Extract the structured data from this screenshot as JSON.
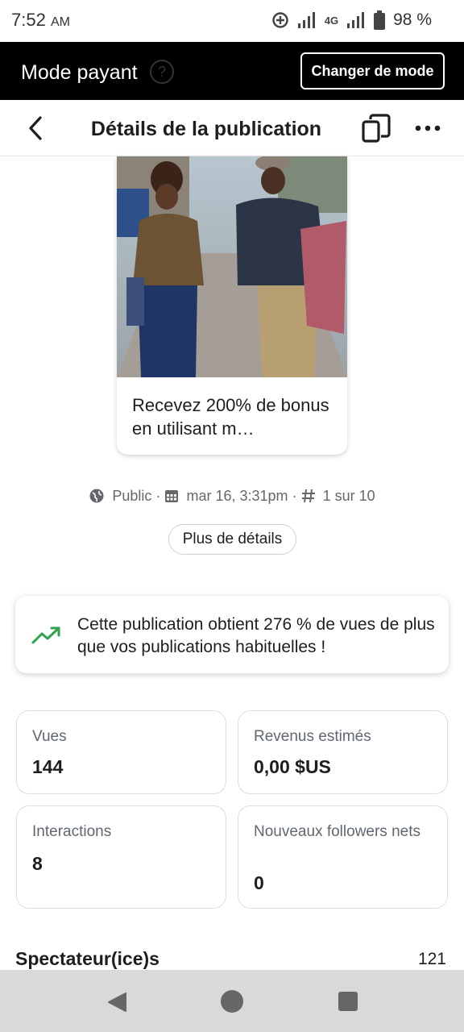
{
  "status_bar": {
    "time": "7:52",
    "ampm": "AM",
    "network": "4G",
    "battery": "98 %"
  },
  "mode_bar": {
    "title": "Mode payant",
    "help_icon": "question-icon",
    "change_button": "Changer de mode"
  },
  "header": {
    "title": "Détails de la publication",
    "back_icon": "chevron-left-icon",
    "copy_icon": "copy-icon",
    "more_icon": "more-dots-icon"
  },
  "post": {
    "caption": "Recevez 200% de bonus en utilisant m…"
  },
  "meta": {
    "visibility": "Public",
    "date": "mar 16, 3:31pm",
    "rank": "1 sur 10",
    "details_button": "Plus de détails"
  },
  "insight": {
    "text": "Cette publication obtient 276 % de vues de plus que vos publications habituelles !",
    "icon": "trending-up-icon",
    "icon_color": "#31a24c"
  },
  "metrics": [
    {
      "label": "Vues",
      "value": "144"
    },
    {
      "label": "Revenus estimés",
      "value": "0,00 $US"
    },
    {
      "label": "Interactions",
      "value": "8"
    },
    {
      "label": "Nouveaux followers nets",
      "value": "0"
    }
  ],
  "audience": {
    "label": "Spectateur(ice)s",
    "value": "121"
  }
}
